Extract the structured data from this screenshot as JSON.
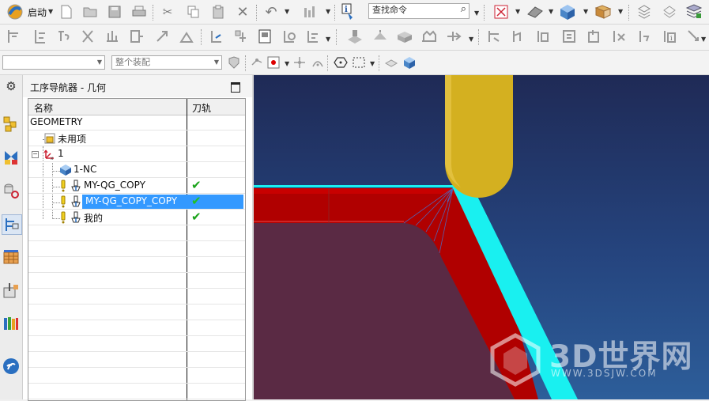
{
  "toolbar1": {
    "start_label": "启动",
    "command_search_placeholder": "查找命令"
  },
  "toolbar3": {
    "selection_filter_value": "",
    "assembly_scope_value": "整个装配"
  },
  "navigator": {
    "title": "工序导航器 - 几何",
    "columns": {
      "name": "名称",
      "toolpath": "刀轨"
    },
    "rows": [
      {
        "label": "GEOMETRY",
        "icon": "none",
        "toolpath_ok": false
      },
      {
        "label": "未用项",
        "icon": "unused-items-icon",
        "toolpath_ok": false
      },
      {
        "label": "1",
        "icon": "mcs-icon",
        "toolpath_ok": false
      },
      {
        "label": "1-NC",
        "icon": "workpiece-icon",
        "toolpath_ok": false
      },
      {
        "label": "MY-QG_COPY",
        "icon": "operation-icon",
        "toolpath_ok": true
      },
      {
        "label": "MY-QG_COPY_COPY",
        "icon": "operation-icon",
        "toolpath_ok": true,
        "selected": true
      },
      {
        "label": "我的",
        "icon": "operation-icon",
        "toolpath_ok": true
      }
    ]
  },
  "watermark": {
    "brand": "3D世界网",
    "url": "WWW.3DSJW.COM"
  },
  "colors": {
    "selection": "#3399ff",
    "tool": "#d4b020",
    "part_red": "#b00000",
    "toolpath_cyan": "#19f0f0",
    "check_green": "#1aa31a"
  }
}
